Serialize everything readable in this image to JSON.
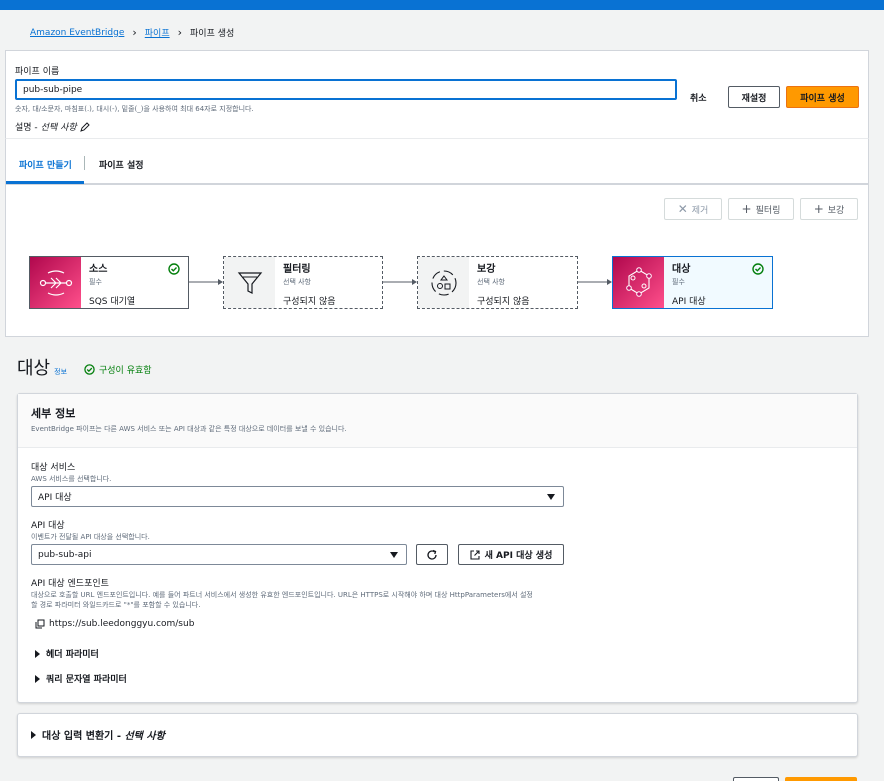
{
  "breadcrumb": {
    "root": "Amazon EventBridge",
    "parent": "파이프",
    "current": "파이프 생성"
  },
  "pipe_name": {
    "label": "파이프 이름",
    "value": "pub-sub-pipe",
    "hint": "숫자, 대/소문자, 마침표(.), 대시(-), 밑줄(_)을 사용하여 최대 64자로 지정합니다."
  },
  "description": {
    "label": "설명 - ",
    "optional": "선택 사항"
  },
  "header_buttons": {
    "cancel": "취소",
    "reset": "재설정",
    "create": "파이프 생성"
  },
  "tabs": [
    {
      "label": "파이프 만들기"
    },
    {
      "label": "파이프 설정"
    }
  ],
  "canvas_buttons": {
    "remove": "제거",
    "filter": "필터링",
    "enrich": "보강"
  },
  "nodes": {
    "source": {
      "title": "소스",
      "sub": "필수",
      "value": "SQS 대기열"
    },
    "filter": {
      "title": "필터링",
      "sub": "선택 사항",
      "value": "구성되지 않음"
    },
    "enrich": {
      "title": "보강",
      "sub": "선택 사항",
      "value": "구성되지 않음"
    },
    "target": {
      "title": "대상",
      "sub": "필수",
      "value": "API 대상"
    }
  },
  "section": {
    "title": "대상",
    "info": "정보",
    "status": "구성이 유효함"
  },
  "details": {
    "title": "세부 정보",
    "desc": "EventBridge 파이프는 다른 AWS 서비스 또는 API 대상과 같은 특정 대상으로 데이터를 보낼 수 있습니다.",
    "target_service": {
      "label": "대상 서비스",
      "hint": "AWS 서비스를 선택합니다.",
      "value": "API 대상"
    },
    "api_dest": {
      "label": "API 대상",
      "hint": "이벤트가 전달될 API 대상을 선택합니다.",
      "value": "pub-sub-api",
      "new_button": "새 API 대상 생성"
    },
    "endpoint": {
      "label": "API 대상 엔드포인트",
      "hint1": "대상으로 호출할 URL 엔드포인트입니다. 예를 들어 파트너 서비스에서 생성한 유효한 엔드포인트입니다. URL은 HTTPS로 시작해야 하며 대상 HttpParameters에서 설정",
      "hint2": "할 경로 파라미터 와일드카드로 \"*\"를 포함할 수 있습니다.",
      "url": "https://sub.leedonggyu.com/sub"
    },
    "header_params": "헤더 파라미터",
    "query_params": "쿼리 문자열 파라미터"
  },
  "input_transformer": {
    "title": "대상 입력 변환기 - ",
    "optional": "선택 사항"
  },
  "colors": {
    "primary": "#ff9900",
    "link": "#0972d3",
    "success": "#037f0c",
    "pink": "#e7157b"
  }
}
